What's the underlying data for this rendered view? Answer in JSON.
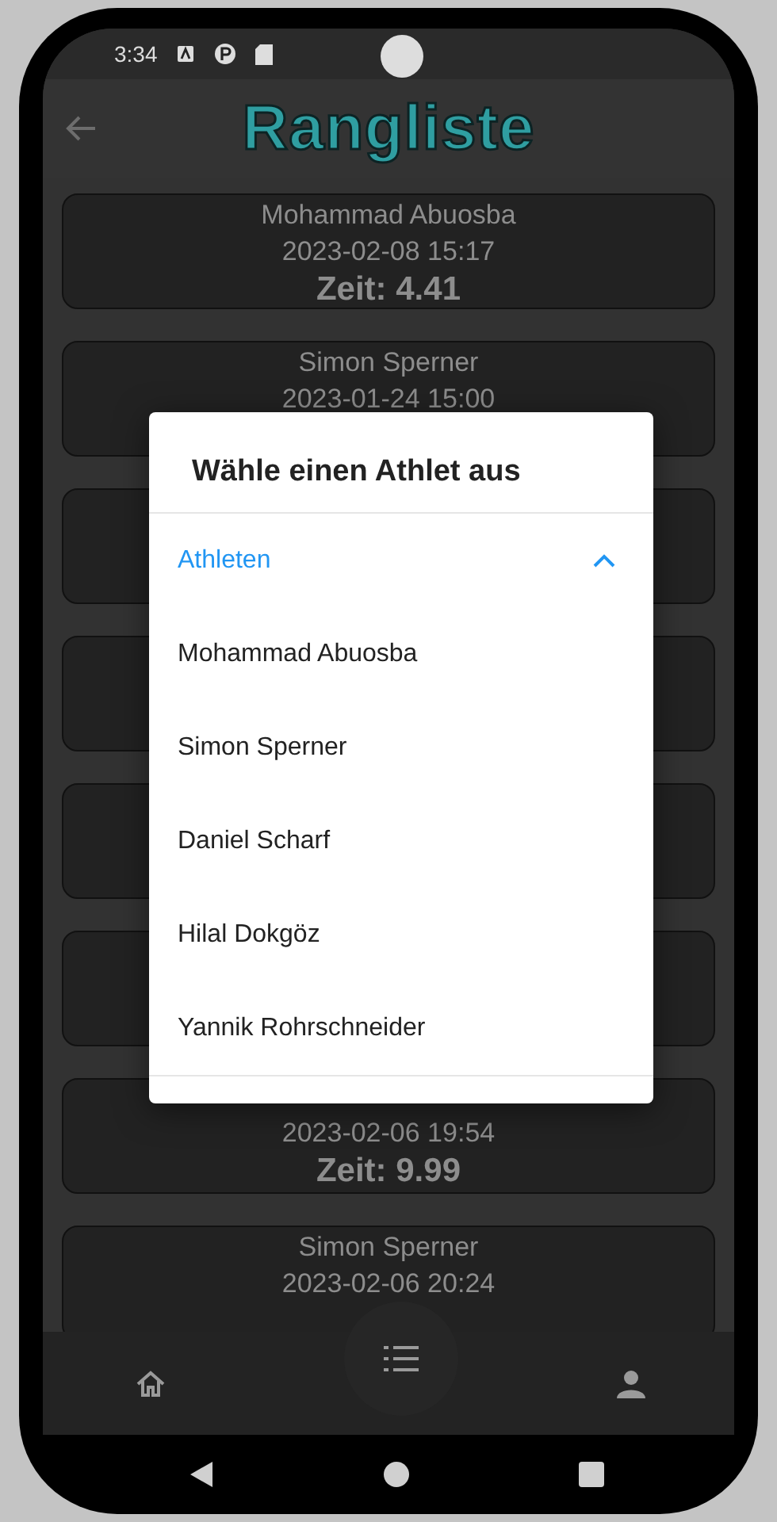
{
  "status_bar": {
    "time": "3:34"
  },
  "app_bar": {
    "title": "Rangliste"
  },
  "results": [
    {
      "kind": "result",
      "name": "Mohammad Abuosba",
      "datetime": "2023-02-08 15:17",
      "time": "Zeit: 4.41"
    },
    {
      "kind": "result",
      "name": "Simon Sperner",
      "datetime": "2023-01-24 15:00"
    },
    {
      "kind": "covered"
    },
    {
      "kind": "covered"
    },
    {
      "kind": "covered"
    },
    {
      "kind": "covered"
    },
    {
      "kind": "result",
      "datetime": "2023-02-06 19:54",
      "time": "Zeit: 9.99"
    },
    {
      "kind": "result",
      "name": "Simon Sperner",
      "datetime": "2023-02-06 20:24"
    }
  ],
  "dialog": {
    "title": "Wähle einen Athlet aus",
    "section": {
      "label": "Athleten",
      "expanded": true
    },
    "athletes": [
      "Mohammad Abuosba",
      "Simon Sperner",
      "Daniel Scharf",
      "Hilal Dokgöz",
      "Yannik Rohrschneider"
    ]
  },
  "bottom_nav": {
    "items": [
      {
        "kind": "home"
      },
      {
        "kind": "list"
      },
      {
        "kind": "profile"
      }
    ]
  }
}
